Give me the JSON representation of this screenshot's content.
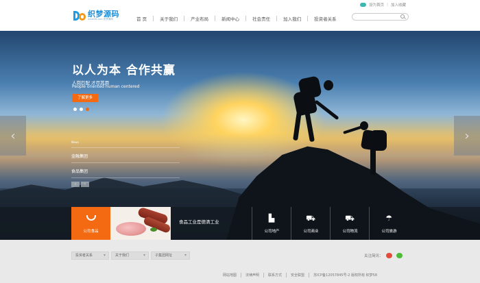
{
  "header": {
    "logo_cn": "织梦源码",
    "logo_en": "dede58.com 织梦源码",
    "top_links": [
      "设为首页",
      "加入收藏"
    ],
    "nav": [
      "首 页",
      "关于我们",
      "产业布局",
      "新闻中心",
      "社会责任",
      "加入我们",
      "投资者关系"
    ],
    "search_placeholder": ""
  },
  "hero": {
    "title": "以人为本  合作共赢",
    "subtitle_cn": "人岗匹配 才尽其用",
    "subtitle_en": "People oriented  human centered",
    "button": "了解更多",
    "news_label": "News",
    "news": [
      "金融集团",
      "食品集团"
    ],
    "prev_glyph": "‹",
    "next_glyph": "›"
  },
  "strip": {
    "card1_label": "公司食品",
    "text": "食品工业是德清工业",
    "cells": [
      {
        "icon": "building-icon",
        "glyph": "▙",
        "label": "公司地产"
      },
      {
        "icon": "cart-icon",
        "glyph": "⛟",
        "label": "公司商业"
      },
      {
        "icon": "truck-icon",
        "glyph": "⛟",
        "label": "公司物流"
      },
      {
        "icon": "palm-icon",
        "glyph": "☂",
        "label": "公司旅游"
      }
    ]
  },
  "footer": {
    "selects": [
      "投资者关系",
      "关于我们",
      "子集团网址"
    ],
    "follow": "关注简讯：",
    "links": [
      "网站地图",
      "法律声明",
      "联系方式",
      "安全联盟",
      "苏ICP备12057845号-2 版权所有 织梦58"
    ]
  },
  "colors": {
    "accent": "#f36a12",
    "brand": "#1e8ed8"
  }
}
